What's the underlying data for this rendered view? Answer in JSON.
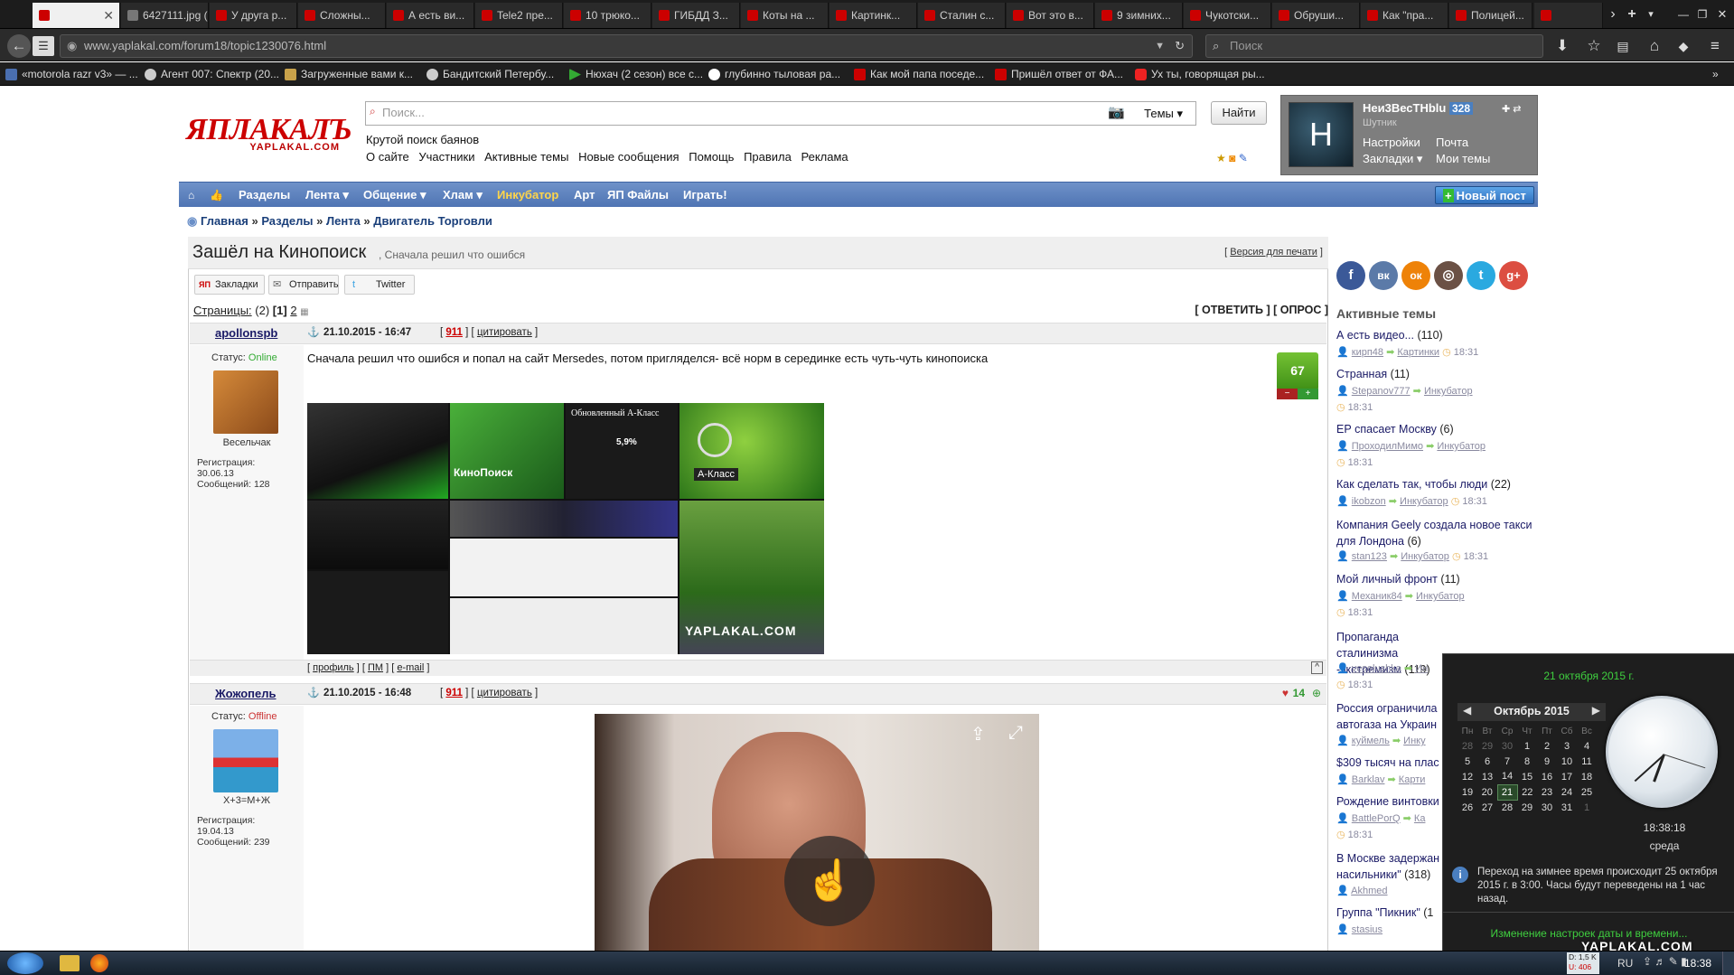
{
  "browser": {
    "tabs": [
      "",
      "6427111.jpg (...",
      "У друга р...",
      "Сложны...",
      "А есть ви...",
      "Tele2 пре...",
      "10 трюко...",
      "ГИБДД З...",
      "Коты на ...",
      "Картинк...",
      "Сталин с...",
      "Вот это в...",
      "9 зимних...",
      "Чукотски...",
      "Обруши...",
      "Как \"пра...",
      "Полицей..."
    ],
    "url": "www.yaplakal.com/forum18/topic1230076.html",
    "search_placeholder": "Поиск",
    "bookmarks": [
      "«motorola razr v3» — ...",
      "Агент 007: Спектр (20...",
      "Загруженные вами к...",
      "Бандитский Петербу...",
      "Нюхач (2 сезон) все с...",
      "глубинно тыловая ра...",
      "Как мой папа поседе...",
      "Пришёл ответ от ФА...",
      "Ух ты, говорящая ры..."
    ]
  },
  "site": {
    "logo_main": "ЯПЛАКАЛЪ",
    "logo_sub": "YAPLAKAL.COM",
    "search_placeholder": "Поиск...",
    "search_scope": "Темы",
    "find_button": "Найти",
    "slogan": "Крутой поиск баянов",
    "top_links": [
      "О сайте",
      "Участники",
      "Активные темы",
      "Новые сообщения",
      "Помощь",
      "Правила",
      "Реклама"
    ],
    "user": {
      "name": "Неи3ВесТНblu",
      "score": "328",
      "rank": "Шутник",
      "avatar_letter": "Н",
      "links": [
        "Настройки",
        "Почта",
        "Закладки",
        "Мои темы"
      ]
    },
    "menu": [
      "Разделы",
      "Лента",
      "Общение",
      "Хлам",
      "Инкубатор",
      "Арт",
      "ЯП Файлы",
      "Играть!"
    ],
    "new_post": "Новый пост",
    "breadcrumbs": [
      "Главная",
      "Разделы",
      "Лента",
      "Двигатель Торговли"
    ]
  },
  "topic": {
    "title": "Зашёл на Кинопоиск",
    "subtitle": ", Сначала решил что ошибся",
    "print_version": "Версия для печати",
    "share": [
      "Закладки",
      "Отправить",
      "Twitter"
    ],
    "pages_label": "Страницы:",
    "pages_count": "(2)",
    "pages": [
      "[1]",
      "2"
    ],
    "reply": "[ ОТВЕТИТЬ ] [ ОПРОС ]"
  },
  "posts": [
    {
      "author": "apollonspb",
      "status_label": "Статус:",
      "status": "Online",
      "user_title": "Весельчак",
      "reg_label": "Регистрация:",
      "reg_date": "30.06.13",
      "msgs": "Сообщений: 128",
      "date": "21.10.2015 - 16:47",
      "num": "911",
      "quote": "цитировать",
      "text": "Сначала решил что ошибся и попал на сайт Mersedes, потом пригляделся- всё норм в серединке есть чуть-чуть кинопоиска",
      "rating": "67",
      "footer": [
        "профиль",
        "ПМ",
        "e-mail"
      ],
      "image_texts": [
        "КиноПоиск",
        "Обновленный A-Класс",
        "5,9%",
        "A-Класс",
        "YAPLAKAL.COM"
      ]
    },
    {
      "author": "Жожопель",
      "status_label": "Статус:",
      "status": "Offline",
      "user_title": "Х+3=М+Ж",
      "reg_label": "Регистрация:",
      "reg_date": "19.04.13",
      "msgs": "Сообщений: 239",
      "date": "21.10.2015 - 16:48",
      "num": "911",
      "quote": "цитировать",
      "rating": "14"
    }
  ],
  "sidebar": {
    "social": [
      "f",
      "вк",
      "ок",
      "◎",
      "t",
      "g+"
    ],
    "heading": "Активные темы",
    "topics": [
      {
        "title": "А есть видео...",
        "count": "(110)",
        "user": "кирп48",
        "section": "Картинки",
        "time": "18:31"
      },
      {
        "title": "Странная",
        "count": "(11)",
        "user": "Stepanov777",
        "section": "Инкубатор",
        "time": "18:31"
      },
      {
        "title": "ЕР спасает Москву",
        "count": "(6)",
        "user": "ПроходилМимо",
        "section": "Инкубатор",
        "time": "18:31"
      },
      {
        "title": "Как сделать так, чтобы люди",
        "count": "(22)",
        "user": "ikobzon",
        "section": "Инкубатор",
        "time": "18:31"
      },
      {
        "title": "Компания Geely создала новое такси для Лондона",
        "count": "(6)",
        "user": "stan123",
        "section": "Инкубатор",
        "time": "18:31"
      },
      {
        "title": "Мой личный фронт",
        "count": "(11)",
        "user": "Механик84",
        "section": "Инкубатор",
        "time": "18:31"
      },
      {
        "title": "Пропаганда сталинизма -экстремизм",
        "count": "(119)",
        "user": "veselushka",
        "section": "Ин",
        "time": "18:31"
      },
      {
        "title": "Россия ограничила автогаза на Украин",
        "count": "",
        "user": "куймель",
        "section": "Инку",
        "time": ""
      },
      {
        "title": "$309 тысяч на плас",
        "count": "",
        "user": "Barklav",
        "section": "Карти",
        "time": "18:31"
      },
      {
        "title": "Рождение винтовки",
        "count": "",
        "user": "BattlePorQ",
        "section": "Ка",
        "time": "18:31"
      },
      {
        "title": "В Москве задержан насильники\"",
        "count": "(318)",
        "user": "Akhmed",
        "section": "",
        "time": ""
      },
      {
        "title": "Группа \"Пикник\"",
        "count": "(1",
        "user": "stasius",
        "section": "",
        "time": ""
      }
    ]
  },
  "clock_popup": {
    "date_long": "21 октября 2015 г.",
    "month": "Октябрь 2015",
    "weekdays": [
      "Пн",
      "Вт",
      "Ср",
      "Чт",
      "Пт",
      "Сб",
      "Вс"
    ],
    "weeks": [
      [
        "28",
        "29",
        "30",
        "1",
        "2",
        "3",
        "4"
      ],
      [
        "5",
        "6",
        "7",
        "8",
        "9",
        "10",
        "11"
      ],
      [
        "12",
        "13",
        "14",
        "15",
        "16",
        "17",
        "18"
      ],
      [
        "19",
        "20",
        "21",
        "22",
        "23",
        "24",
        "25"
      ],
      [
        "26",
        "27",
        "28",
        "29",
        "30",
        "31",
        "1"
      ]
    ],
    "today": "21",
    "time": "18:38:18",
    "weekday": "среда",
    "dst_note": "Переход на зимнее время происходит 25 октября 2015 г. в 3:00. Часы будут переведены на 1 час назад.",
    "change_settings": "Изменение настроек даты и времени..."
  },
  "taskbar": {
    "lang": "RU",
    "clock": "18:38",
    "net_d": "D: 1,5 K",
    "net_u": "U: 406"
  },
  "watermark": "YAPLAKAL.COM"
}
